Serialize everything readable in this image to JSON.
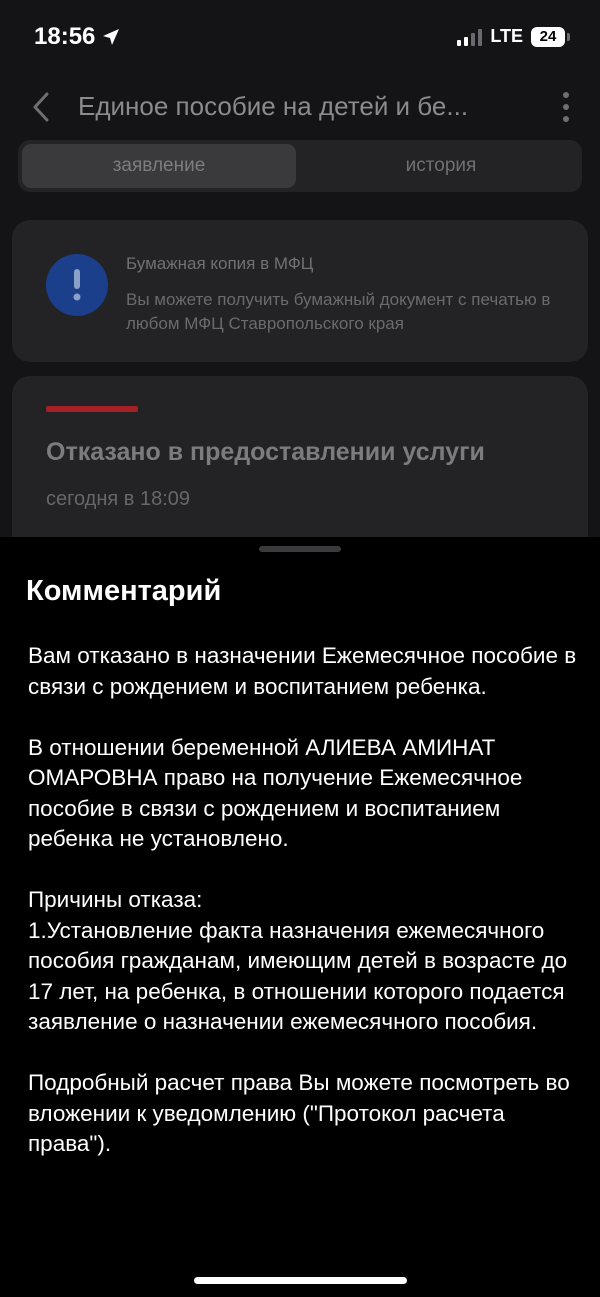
{
  "status_bar": {
    "time": "18:56",
    "network": "LTE",
    "battery": "24"
  },
  "header": {
    "title": "Единое пособие на детей и бе...",
    "back_icon": "chevron-left-icon",
    "menu_icon": "more-vertical-icon"
  },
  "tabs": [
    {
      "label": "заявление",
      "active": true
    },
    {
      "label": "история",
      "active": false
    }
  ],
  "info_card": {
    "title": "Бумажная копия в МФЦ",
    "text": "Вы можете получить бумажный документ с печатью в любом МФЦ Ставропольского края",
    "icon": "exclamation-icon"
  },
  "status_card": {
    "title": "Отказано в предоставлении услуги",
    "time": "сегодня в 18:09",
    "accent_color": "#a51f26"
  },
  "sheet": {
    "title": "Комментарий",
    "paragraphs": [
      "Вам отказано в назначении Ежемесячное пособие в связи с рождением и воспитанием ребенка.",
      "В отношении беременной АЛИЕВА АМИНАТ ОМАРОВНА право на получение Ежемесячное пособие в связи с рождением и воспитанием ребенка не установлено.",
      "Причины отказа:\n1.Установление факта назначения ежемесячного пособия гражданам, имеющим детей в возрасте до 17 лет, на ребенка, в отношении которого подается заявление о назначении ежемесячного пособия.",
      "Подробный расчет права Вы можете посмотреть во вложении к уведомлению (\"Протокол расчета права\")."
    ]
  }
}
